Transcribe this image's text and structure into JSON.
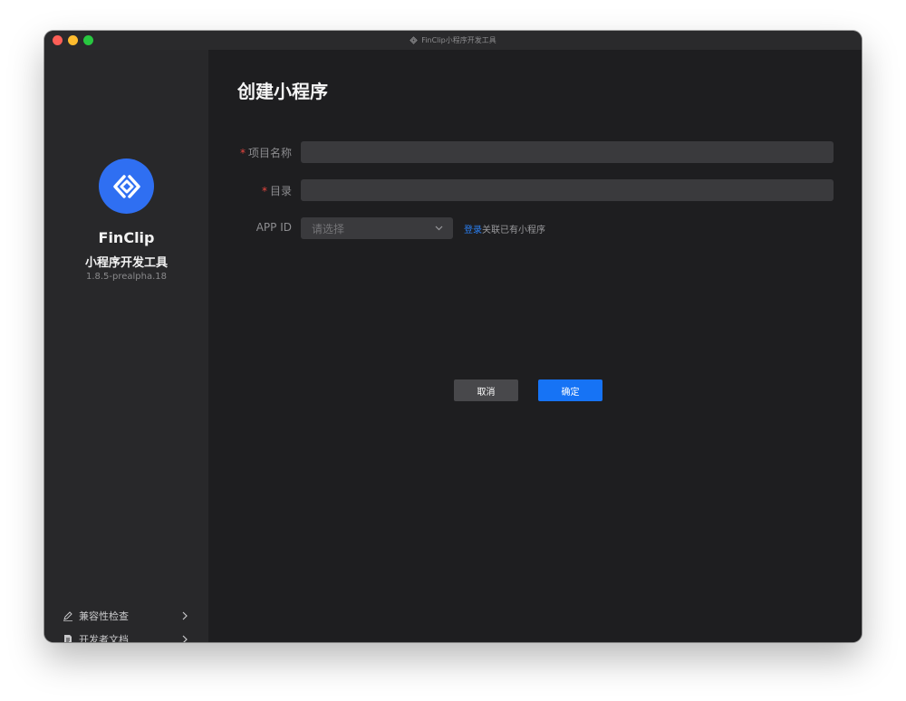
{
  "window": {
    "title": "FinClip小程序开发工具"
  },
  "sidebar": {
    "brand_name": "FinClip",
    "brand_subtitle": "小程序开发工具",
    "version": "1.8.5-prealpha.18",
    "links": [
      {
        "label": "兼容性检查",
        "icon": "pen-icon"
      },
      {
        "label": "开发者文档",
        "icon": "document-icon"
      }
    ]
  },
  "main": {
    "title": "创建小程序",
    "form": {
      "required_mark": "*",
      "project_name_label": "项目名称",
      "project_name_value": "",
      "directory_label": "目录",
      "directory_value": "",
      "appid_label": "APP ID",
      "appid_placeholder": "请选择",
      "login_link": "登录",
      "associate_text": "关联已有小程序"
    },
    "buttons": {
      "cancel": "取消",
      "confirm": "确定"
    }
  },
  "colors": {
    "accent": "#1673f5",
    "required": "#e8463f",
    "logo": "#2f6ff2"
  }
}
